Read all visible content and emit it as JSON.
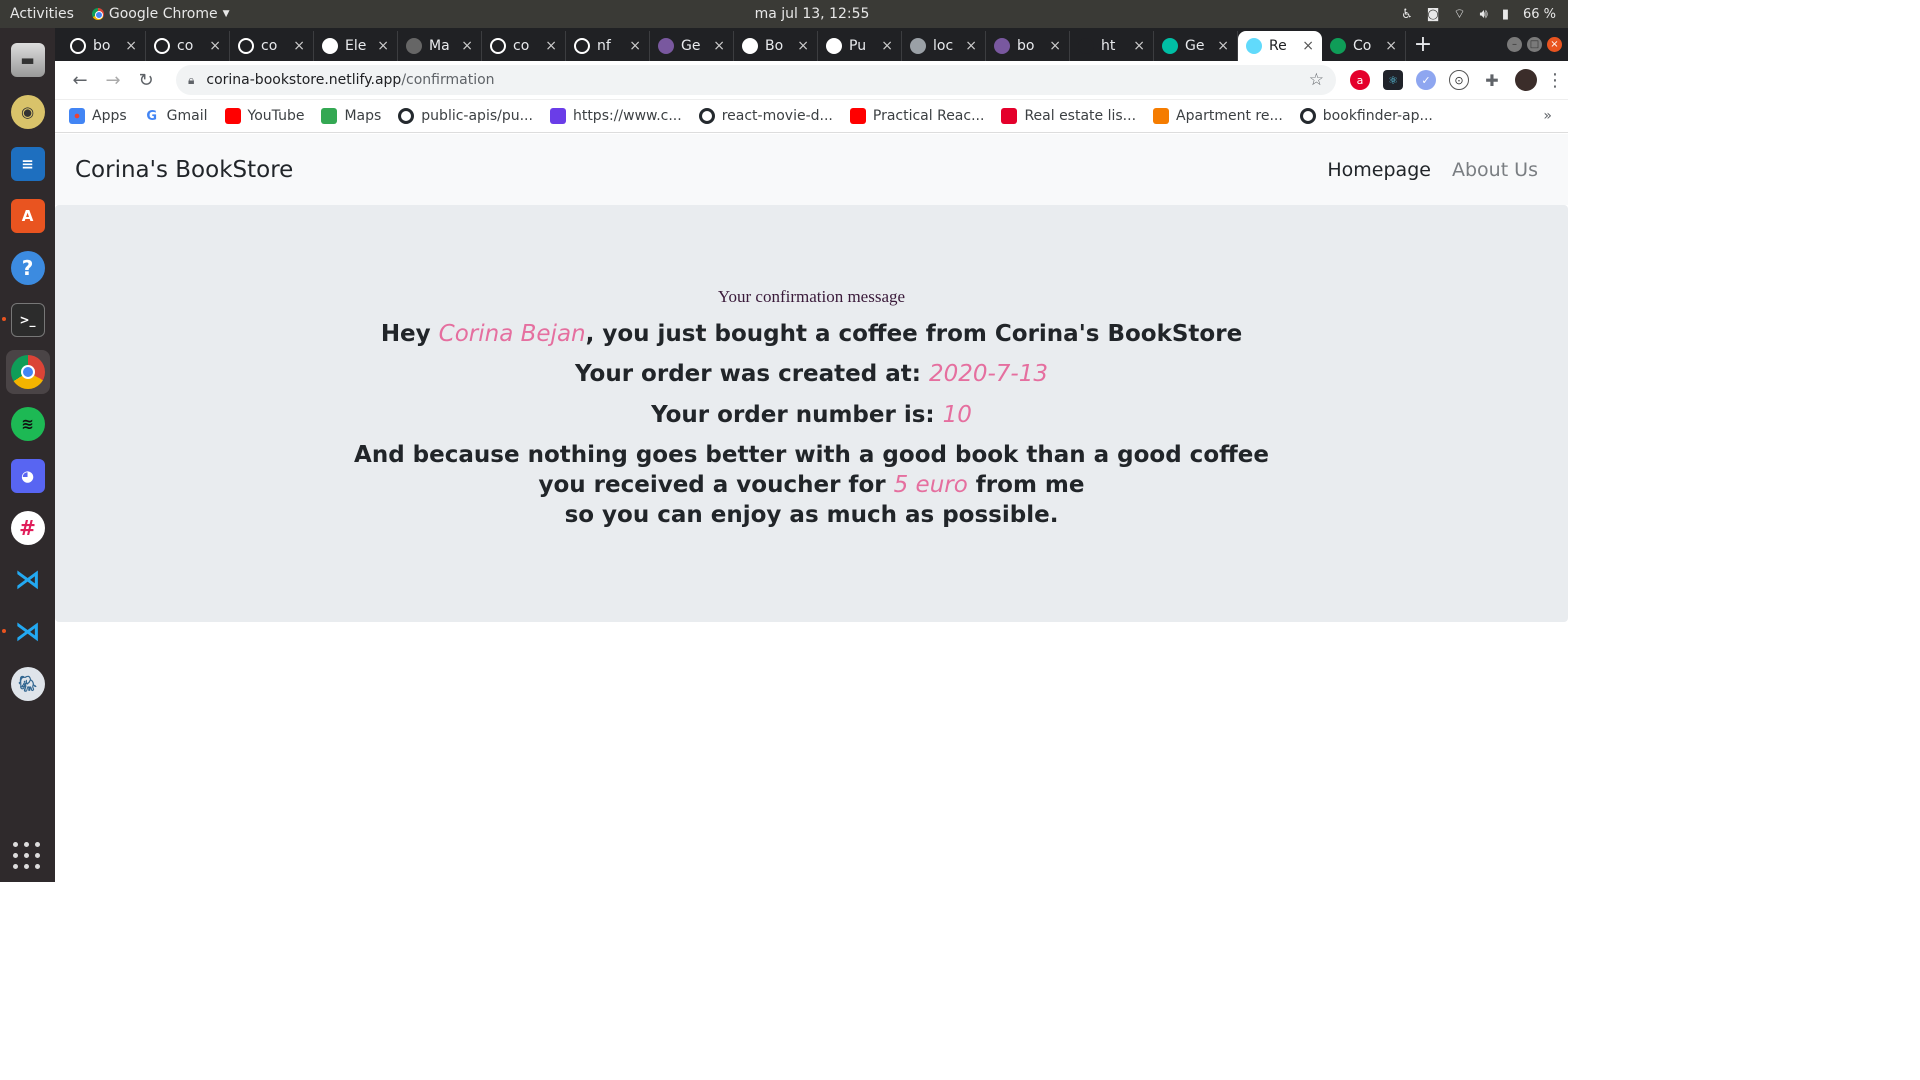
{
  "system": {
    "activities": "Activities",
    "app_name": "Google Chrome",
    "clock": "ma jul 13, 12:55",
    "battery": "66 %"
  },
  "tabs": [
    {
      "title": "bo",
      "icon": "github-icon",
      "color": "#ffffff"
    },
    {
      "title": "co",
      "icon": "github-icon",
      "color": "#ffffff"
    },
    {
      "title": "co",
      "icon": "github-icon",
      "color": "#ffffff"
    },
    {
      "title": "Ele",
      "icon": "elephant-icon",
      "color": "#ffffff"
    },
    {
      "title": "Ma",
      "icon": "page-icon",
      "color": "#666666"
    },
    {
      "title": "co",
      "icon": "github-icon",
      "color": "#ffffff"
    },
    {
      "title": "nf",
      "icon": "github-icon",
      "color": "#ffffff"
    },
    {
      "title": "Ge",
      "icon": "heroku-icon",
      "color": "#79589f"
    },
    {
      "title": "Bo",
      "icon": "openlibrary-icon",
      "color": "#ffffff"
    },
    {
      "title": "Pu",
      "icon": "openlibrary-icon",
      "color": "#ffffff"
    },
    {
      "title": "loc",
      "icon": "globe-icon",
      "color": "#9aa0a6"
    },
    {
      "title": "bo",
      "icon": "heroku-icon",
      "color": "#79589f"
    },
    {
      "title": "ht",
      "icon": "blank-icon",
      "color": "#202124"
    },
    {
      "title": "Ge",
      "icon": "diamond-icon",
      "color": "#00bfa5"
    },
    {
      "title": "Re",
      "icon": "react-icon",
      "color": "#61dafb",
      "active": true
    },
    {
      "title": "Co",
      "icon": "sheets-icon",
      "color": "#0f9d58"
    }
  ],
  "address": {
    "host": "corina-bookstore.netlify.app",
    "path": "/confirmation"
  },
  "bookmarks": [
    {
      "label": "Apps",
      "icon": "apps-icon",
      "color": "#4285f4"
    },
    {
      "label": "Gmail",
      "icon": "google-icon",
      "color": "#ffffff"
    },
    {
      "label": "YouTube",
      "icon": "youtube-icon",
      "color": "#ff0000"
    },
    {
      "label": "Maps",
      "icon": "maps-icon",
      "color": "#34a853"
    },
    {
      "label": "public-apis/pu...",
      "icon": "github-icon",
      "color": "#ffffff"
    },
    {
      "label": "https://www.c...",
      "icon": "c-icon",
      "color": "#6a3de8"
    },
    {
      "label": "react-movie-d...",
      "icon": "github-icon",
      "color": "#ffffff"
    },
    {
      "label": "Practical Reac...",
      "icon": "youtube-icon",
      "color": "#ff0000"
    },
    {
      "label": "Real estate lis...",
      "icon": "home-icon",
      "color": "#e4002b"
    },
    {
      "label": "Apartment re...",
      "icon": "apartment-icon",
      "color": "#f57c00"
    },
    {
      "label": "bookfinder-ap...",
      "icon": "github-icon",
      "color": "#ffffff"
    }
  ],
  "site": {
    "brand": "Corina's BookStore",
    "nav": {
      "homepage": "Homepage",
      "about": "About Us"
    }
  },
  "confirmation": {
    "caption": "Your confirmation message",
    "hey": "Hey ",
    "customer": "Corina Bejan",
    "bought": ", you just bought a coffee from Corina's BookStore",
    "created_label": "Your order was created at: ",
    "created_date": "2020-7-13",
    "number_label": "Your order number is: ",
    "order_number": "10",
    "line1": "And because nothing goes better with a good book than a good coffee",
    "voucher_pre": "you received a voucher for ",
    "voucher_amount": "5 euro",
    "voucher_post": " from me",
    "line3": "so you can enjoy as much as possible."
  },
  "colors": {
    "accent": "#e56f9f",
    "jumbotron": "#e9ecef",
    "navbar": "#f8f9fa"
  }
}
